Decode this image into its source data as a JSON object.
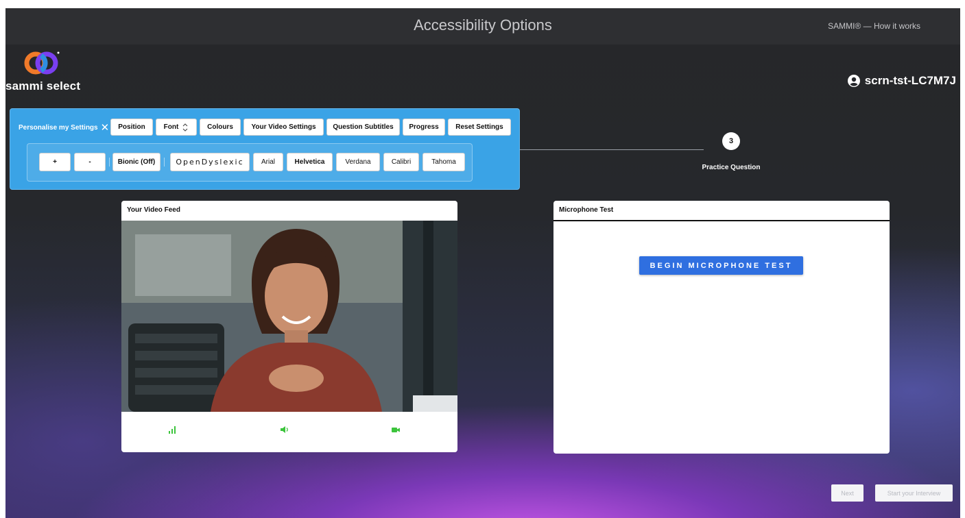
{
  "header": {
    "title": "Accessibility Options",
    "how_it_works": "SAMMI® — How it works"
  },
  "brand": {
    "name": "sammi select",
    "colors": {
      "ring_orange": "#f07a2a",
      "ring_purple": "#7a3ff0",
      "ring_blue": "#2f8fe0"
    }
  },
  "user": {
    "id": "scrn-tst-LC7M7J",
    "icon": "user-circle-icon"
  },
  "settings": {
    "label": "Personalise my Settings",
    "close_icon": "close-icon",
    "tabs": [
      {
        "label": "Position"
      },
      {
        "label": "Font",
        "icon": "expand-icon"
      },
      {
        "label": "Colours"
      },
      {
        "label": "Your Video Settings"
      },
      {
        "label": "Question Subtitles"
      },
      {
        "label": "Progress"
      },
      {
        "label": "Reset Settings"
      }
    ],
    "font_options": {
      "increase": "+",
      "decrease": "-",
      "bionic": "Bionic (Off)",
      "fonts": [
        "OpenDyslexic",
        "Arial",
        "Helvetica",
        "Verdana",
        "Calibri",
        "Tahoma"
      ]
    },
    "panel_color": "#3aa3e6"
  },
  "progress": {
    "step_number": "3",
    "step_label": "Practice Question"
  },
  "video_feed": {
    "title": "Your Video Feed",
    "icons": [
      "signal-icon",
      "speaker-icon",
      "camera-icon"
    ],
    "icon_color": "#3cc43c"
  },
  "microphone": {
    "title": "Microphone Test",
    "button_label": "BEGIN MICROPHONE TEST",
    "button_color": "#2f6fe0"
  },
  "footer": {
    "next_label": "Next",
    "start_label": "Start your Interview"
  }
}
